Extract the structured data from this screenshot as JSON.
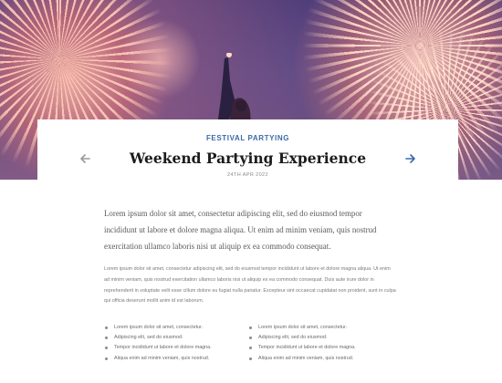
{
  "hero": {
    "image": "fireworks-night-sky"
  },
  "card": {
    "kicker": "FESTIVAL PARTYING",
    "title": "Weekend Partying Experience",
    "date": "24TH APR 2022",
    "prev_icon": "arrow-left-icon",
    "next_icon": "arrow-right-icon",
    "prev_color": "#9a9a9a",
    "next_color": "#3b6aa8"
  },
  "content": {
    "lead": "Lorem ipsum dolor sit amet, consectetur adipiscing elit, sed do eiusmod tempor incididunt ut labore et dolore magna aliqua. Ut enim ad minim veniam, quis nostrud exercitation ullamco laboris nisi ut aliquip ex ea commodo consequat.",
    "paragraph": "Lorem ipsum dolor sit amet, consectetur adipiscing elit, sed do eiusmod tempor incididunt ut labore et dolore magna aliqua. Ut enim ad minim veniam, quis nostrud exercitation ullamco laboris nisi ut aliquip ex ea commodo consequat. Duis aute irure dolor in reprehenderit in voluptate velit esse cillum dolore eu fugiat nulla pariatur. Excepteur sint occaecat cupidatat non proident, sunt in culpa qui officia deserunt mollit anim id est laborum.",
    "list_left": [
      "Lorem ipsum dolor sit amet, consectetur.",
      "Adipiscing elit, sed do eiusmod.",
      "Tempor incididunt ut labore et dolore magna.",
      "Aliqua enim ad minim veniam, quis nostrud."
    ],
    "list_right": [
      "Lorem ipsum dolor sit amet, consectetur.",
      "Adipiscing elit, sed do eiusmod.",
      "Tempor incididunt ut labore et dolore magna.",
      "Aliqua enim ad minim veniam, quis nostrud."
    ]
  }
}
